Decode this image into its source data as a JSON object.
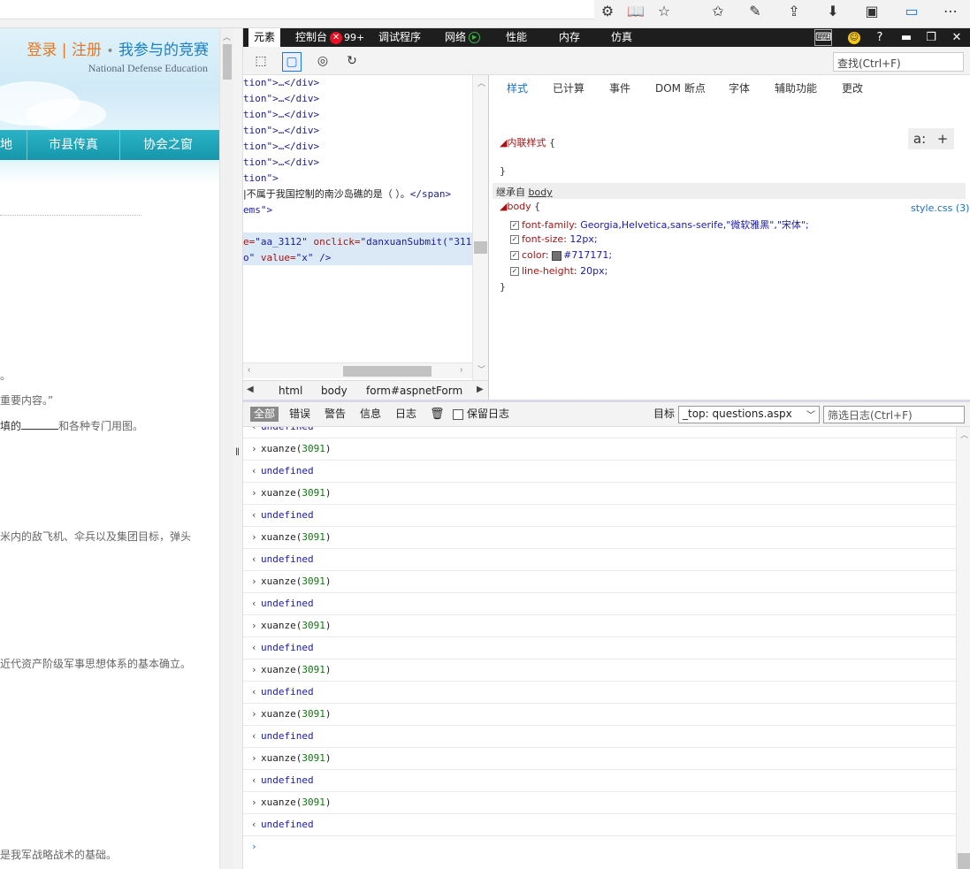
{
  "browser": {
    "icons": [
      "extensions-icon",
      "reading-view-icon",
      "favorite-star-icon",
      "favorites-hub-icon",
      "pen-icon",
      "share-icon",
      "download-icon",
      "extension-icon",
      "notes-icon",
      "more-icon"
    ]
  },
  "page": {
    "login_text": "登录",
    "sep": "|",
    "register_text": "注册",
    "dot": "•",
    "my_contests_text": "我参与的竞赛",
    "subtitle": "National Defense Education",
    "nav": [
      "地",
      "市县传真",
      "协会之窗"
    ],
    "q_lines": [
      "。",
      "重要内容。”",
      "米内的敌飞机、伞兵以及集团目标，弹头",
      "近代资产阶级军事思想体系的基本确立。",
      "是我军战略战术的基础。"
    ],
    "q_blank_prefix": "填的",
    "q_blank_suffix": "和各种专门用图。"
  },
  "devtools": {
    "tabs": {
      "elements": "元素",
      "console": "控制台",
      "error_badge": "✕",
      "error_count": "99+",
      "debugger": "调试程序",
      "network": "网络",
      "network_icon": "▶",
      "performance": "性能",
      "memory": "内存",
      "emulation": "仿真"
    },
    "find_placeholder": "查找(Ctrl+F)",
    "dom": {
      "lines": [
        {
          "a": "tion\"",
          "b": ">…</div>"
        },
        {
          "a": "tion\"",
          "b": ">…</div>"
        },
        {
          "a": "tion\"",
          "b": ">…</div>"
        },
        {
          "a": "tion\"",
          "b": ">…</div>"
        },
        {
          "a": "tion\"",
          "b": ">…</div>"
        },
        {
          "a": "tion\"",
          "b": ">…</div>"
        },
        {
          "a": "tion\"",
          "b": ">"
        }
      ],
      "text_line_main": "|不属于我国控制的南沙岛礁的是（ ）。",
      "text_line_tag": "</span>",
      "ems_line": "ems\">",
      "sel_line1_attr": "e=",
      "sel_line1_val": "\"aa_3112\"",
      "sel_line1_attr2": " onclick=",
      "sel_line1_val2": "\"danxuanSubmit(\"311",
      "sel_line2_val": "o\"",
      "sel_line2_attr": " value=",
      "sel_line2_val2": "\"x\"",
      "sel_line2_end": " />"
    },
    "breadcrumb": [
      "html",
      "body",
      "form#aspnetForm"
    ],
    "styles": {
      "tabs": [
        "样式",
        "已计算",
        "事件",
        "DOM 断点",
        "字体",
        "辅助功能",
        "更改"
      ],
      "inline_label": "◢内联样式",
      "brace_open": "{",
      "brace_close": "}",
      "inherited_from": "继承自",
      "inherited_target": "body",
      "body_selector": "◢body",
      "source_link": "style.css (3)",
      "props": [
        {
          "name": "font-family",
          "value": "Georgia,Helvetica,sans-serife,\"微软雅黑\",\"宋体\";"
        },
        {
          "name": "font-size",
          "value": "12px;"
        },
        {
          "name": "color",
          "value": "#717171;"
        },
        {
          "name": "line-height",
          "value": "20px;"
        }
      ],
      "color_swatch": "#717171",
      "btn_a": "a:",
      "btn_plus": "+"
    },
    "console": {
      "tabs": [
        "全部",
        "错误",
        "警告",
        "信息",
        "日志"
      ],
      "preserve_log": "保留日志",
      "target_label": "目标",
      "target_value": "_top: questions.aspx",
      "filter_placeholder": "筛选日志(Ctrl+F)",
      "rows": [
        {
          "type": "output",
          "text": "undefined"
        },
        {
          "type": "input",
          "fn": "xuanze(",
          "num": "3091",
          "close": ")"
        },
        {
          "type": "output",
          "text": "undefined"
        },
        {
          "type": "input",
          "fn": "xuanze(",
          "num": "3091",
          "close": ")"
        },
        {
          "type": "output",
          "text": "undefined"
        },
        {
          "type": "input",
          "fn": "xuanze(",
          "num": "3091",
          "close": ")"
        },
        {
          "type": "output",
          "text": "undefined"
        },
        {
          "type": "input",
          "fn": "xuanze(",
          "num": "3091",
          "close": ")"
        },
        {
          "type": "output",
          "text": "undefined"
        },
        {
          "type": "input",
          "fn": "xuanze(",
          "num": "3091",
          "close": ")"
        },
        {
          "type": "output",
          "text": "undefined"
        },
        {
          "type": "input",
          "fn": "xuanze(",
          "num": "3091",
          "close": ")"
        },
        {
          "type": "output",
          "text": "undefined"
        },
        {
          "type": "input",
          "fn": "xuanze(",
          "num": "3091",
          "close": ")"
        },
        {
          "type": "output",
          "text": "undefined"
        },
        {
          "type": "input",
          "fn": "xuanze(",
          "num": "3091",
          "close": ")"
        },
        {
          "type": "output",
          "text": "undefined"
        },
        {
          "type": "input",
          "fn": "xuanze(",
          "num": "3091",
          "close": ")"
        },
        {
          "type": "output",
          "text": "undefined"
        },
        {
          "type": "prompt",
          "text": ""
        }
      ]
    }
  }
}
